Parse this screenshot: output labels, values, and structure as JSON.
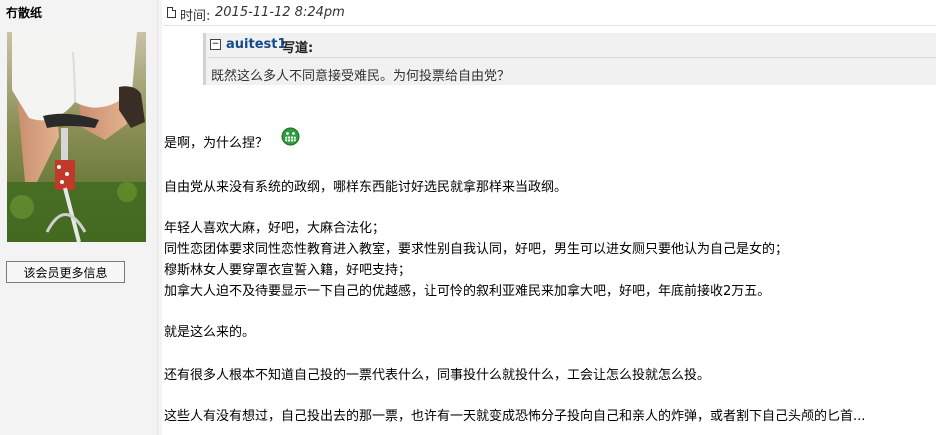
{
  "user": {
    "name": "冇散纸",
    "more_info_button": "该会员更多信息"
  },
  "post": {
    "time_label": "时间:",
    "time_value": "2015-11-12 8:24pm",
    "quote": {
      "toggle": "−",
      "user": "auitest1",
      "said": "写道:",
      "text": "既然这么多人不同意接受难民。为何投票给自由党？"
    },
    "lines": [
      "是啊，为什么捏？",
      "自由党从来没有系统的政纲，哪样东西能讨好选民就拿那样来当政纲。",
      "年轻人喜欢大麻，好吧，大麻合法化；",
      "同性恋团体要求同性恋性教育进入教室，要求性别自我认同，好吧，男生可以进女厕只要他认为自己是女的；",
      "穆斯林女人要穿罩衣宣誓入籍，好吧支持；",
      "加拿大人迫不及待要显示一下自己的优越感，让可怜的叙利亚难民来加拿大吧，好吧，年底前接收2万五。",
      "就是这么来的。",
      "还有很多人根本不知道自己投的一票代表什么，同事投什么就投什么，工会让怎么投就怎么投。",
      "这些人有没有想过，自己投出去的那一票，也许有一天就变成恐怖分子投向自己和亲人的炸弹，或者割下自己头颅的匕首..."
    ],
    "smiley_icon": "grin-smiley-icon"
  },
  "colors": {
    "sidebar_bg": "#f3f3f3",
    "quote_bg": "#f1f1f1",
    "quote_user": "#174a8b",
    "smiley": "#2e9b3c"
  }
}
